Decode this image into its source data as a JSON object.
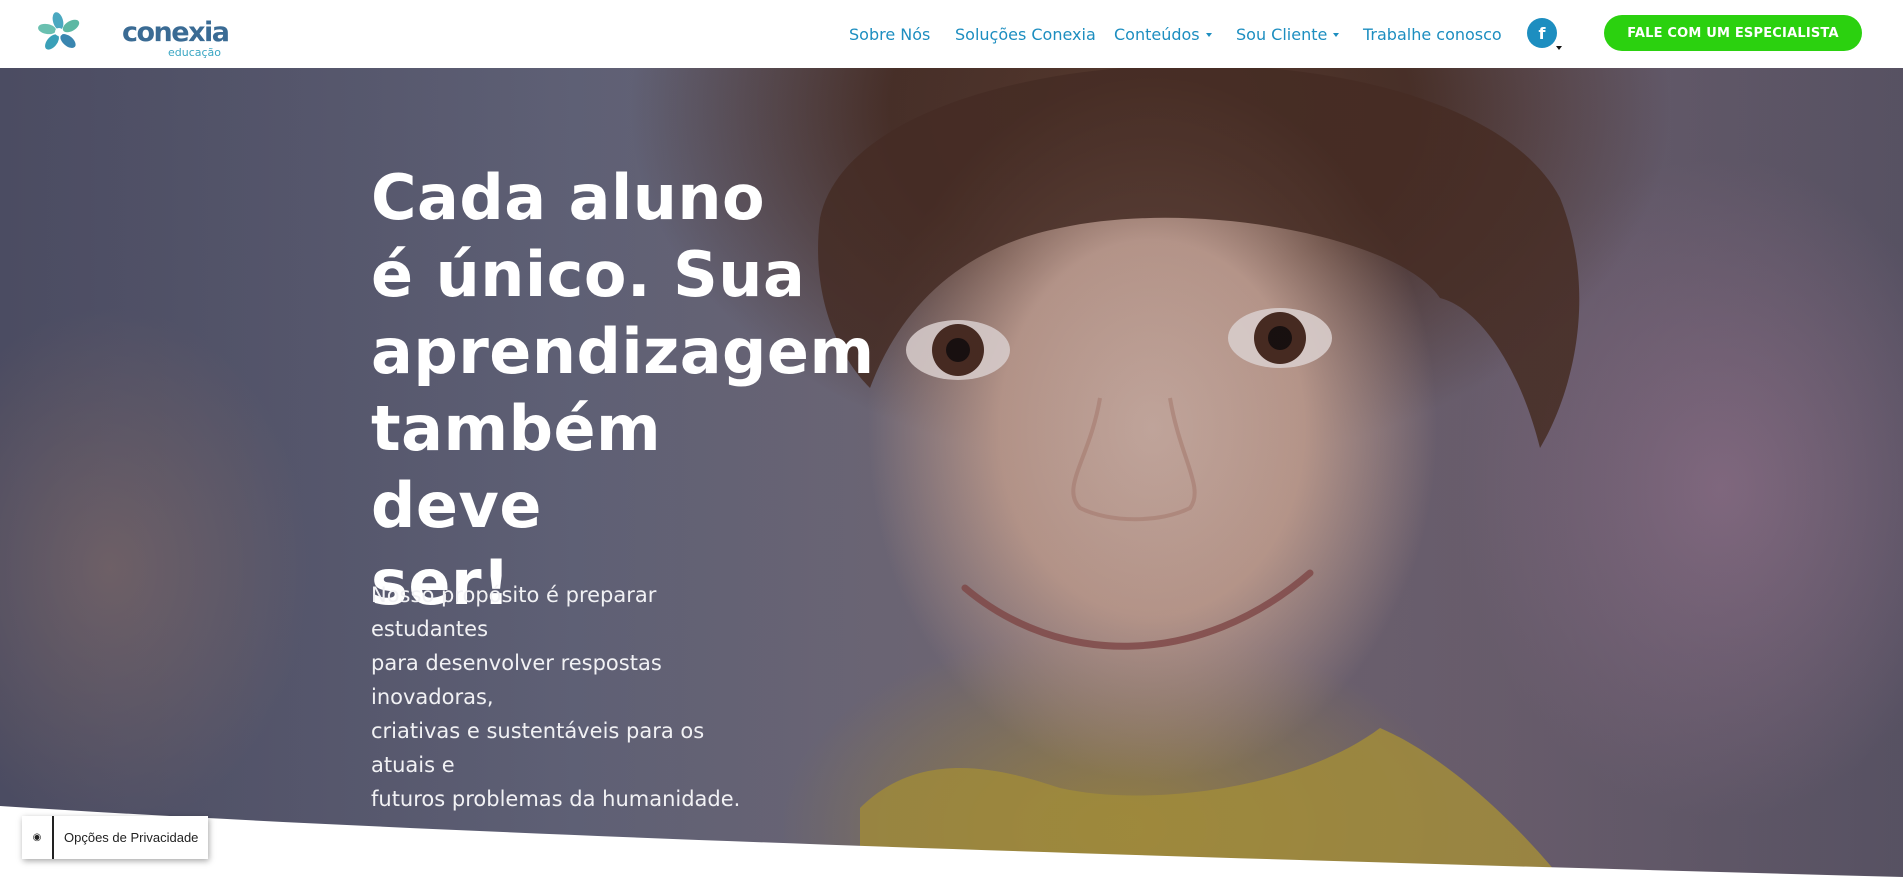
{
  "brand": {
    "name": "conexia",
    "tagline": "educação",
    "primary_color": "#1d8ec0",
    "cta_color": "#2bd10f"
  },
  "nav": {
    "items": [
      {
        "label": "Sobre Nós",
        "has_dropdown": false
      },
      {
        "label": "Soluções Conexia",
        "has_dropdown": false
      },
      {
        "label": "Conteúdos",
        "has_dropdown": true
      },
      {
        "label": "Sou Cliente",
        "has_dropdown": true
      },
      {
        "label": "Trabalhe conosco",
        "has_dropdown": false
      }
    ],
    "social_icon": "facebook-icon",
    "facebook_glyph": "f",
    "cta_label": "FALE COM UM ESPECIALISTA"
  },
  "hero": {
    "title_lines": [
      "Cada aluno",
      "é único. Sua",
      "aprendizagem",
      "também deve",
      "ser!"
    ],
    "text_lines": [
      "Nosso propósito é preparar estudantes",
      "para desenvolver respostas inovadoras,",
      "criativas e sustentáveis para os atuais e",
      "futuros problemas da humanidade."
    ]
  },
  "privacy": {
    "icon": "privacy-eye-icon",
    "label": "Opções de Privacidade"
  }
}
